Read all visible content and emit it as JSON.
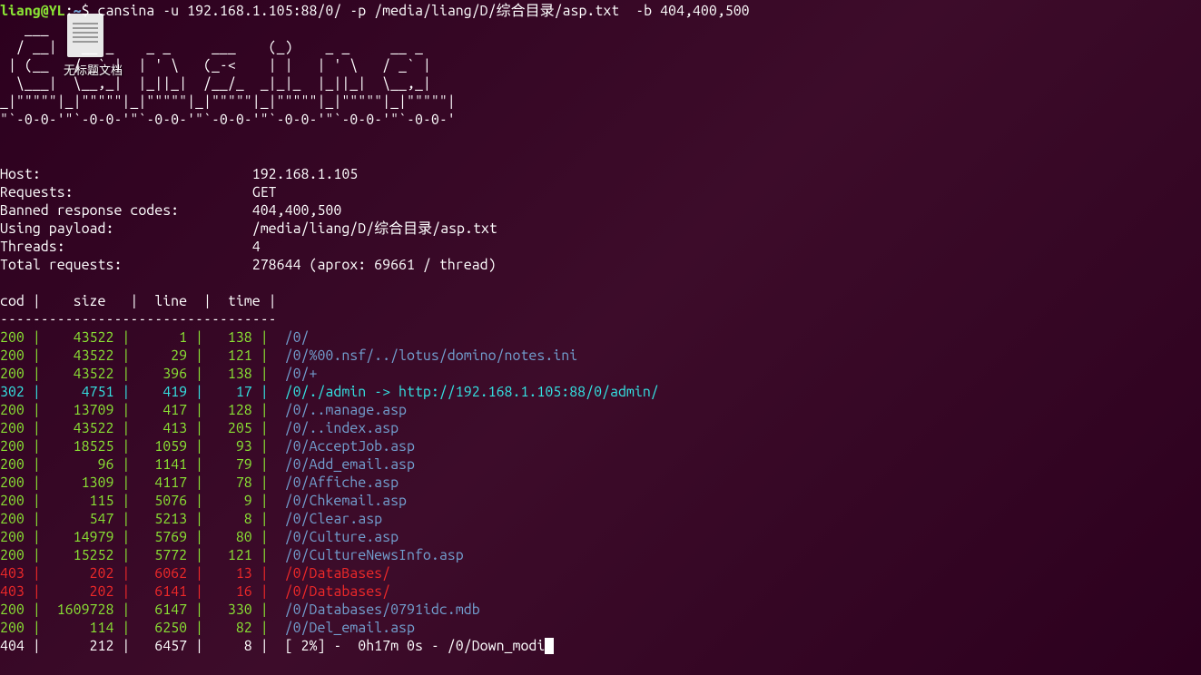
{
  "desktop": {
    "doc_label": "无标题文档"
  },
  "prompt": {
    "user_host": "liang@YL",
    "colon": ":",
    "path": "~",
    "dollar": "$ ",
    "command": "cansina -u 192.168.1.105:88/0/ -p /media/liang/D/综合目录/asp.txt  -b 404,400,500"
  },
  "ascii": [
    "   ___                                             ",
    "  / __|   __ _    _ _     ___    (_)    _ _     __ _  ",
    " | (__   / _` |  | ' \\   (_-<    | |   | ' \\   / _` | ",
    "  \\___|  \\__,_|  |_||_|  /__/_  _|_|_  |_||_|  \\__,_| ",
    "_|\"\"\"\"\"|_|\"\"\"\"\"|_|\"\"\"\"\"|_|\"\"\"\"\"|_|\"\"\"\"\"|_|\"\"\"\"\"|_|\"\"\"\"\"| ",
    "\"`-0-0-'\"`-0-0-'\"`-0-0-'\"`-0-0-'\"`-0-0-'\"`-0-0-'\"`-0-0-' "
  ],
  "info": {
    "host_label": "Host:",
    "host_value": "192.168.1.105",
    "requests_label": "Requests:",
    "requests_value": "GET",
    "banned_label": "Banned response codes:",
    "banned_value": "404,400,500",
    "payload_label": "Using payload:",
    "payload_value": "/media/liang/D/综合目录/asp.txt",
    "threads_label": "Threads:",
    "threads_value": "4",
    "total_label": "Total requests:",
    "total_value": "278644 (aprox: 69661 / thread)"
  },
  "table": {
    "header": "cod |    size   |  line  |  time |",
    "divider": "----------------------------------",
    "rows": [
      {
        "code": "200",
        "size": "43522",
        "line": "1",
        "time": "138",
        "path": "/0/",
        "cls": "c200",
        "pcls": "path-normal"
      },
      {
        "code": "200",
        "size": "43522",
        "line": "29",
        "time": "121",
        "path": "/0/%00.nsf/../lotus/domino/notes.ini",
        "cls": "c200",
        "pcls": "path-normal"
      },
      {
        "code": "200",
        "size": "43522",
        "line": "396",
        "time": "138",
        "path": "/0/+",
        "cls": "c200",
        "pcls": "path-normal"
      },
      {
        "code": "302",
        "size": "4751",
        "line": "419",
        "time": "17",
        "path": "/0/./admin -> http://192.168.1.105:88/0/admin/",
        "cls": "c302",
        "pcls": "path-redir"
      },
      {
        "code": "200",
        "size": "13709",
        "line": "417",
        "time": "128",
        "path": "/0/..manage.asp",
        "cls": "c200",
        "pcls": "path-normal"
      },
      {
        "code": "200",
        "size": "43522",
        "line": "413",
        "time": "205",
        "path": "/0/..index.asp",
        "cls": "c200",
        "pcls": "path-normal"
      },
      {
        "code": "200",
        "size": "18525",
        "line": "1059",
        "time": "93",
        "path": "/0/AcceptJob.asp",
        "cls": "c200",
        "pcls": "path-normal"
      },
      {
        "code": "200",
        "size": "96",
        "line": "1141",
        "time": "79",
        "path": "/0/Add_email.asp",
        "cls": "c200",
        "pcls": "path-normal"
      },
      {
        "code": "200",
        "size": "1309",
        "line": "4117",
        "time": "78",
        "path": "/0/Affiche.asp",
        "cls": "c200",
        "pcls": "path-normal"
      },
      {
        "code": "200",
        "size": "115",
        "line": "5076",
        "time": "9",
        "path": "/0/Chkemail.asp",
        "cls": "c200",
        "pcls": "path-normal"
      },
      {
        "code": "200",
        "size": "547",
        "line": "5213",
        "time": "8",
        "path": "/0/Clear.asp",
        "cls": "c200",
        "pcls": "path-normal"
      },
      {
        "code": "200",
        "size": "14979",
        "line": "5769",
        "time": "80",
        "path": "/0/Culture.asp",
        "cls": "c200",
        "pcls": "path-normal"
      },
      {
        "code": "200",
        "size": "15252",
        "line": "5772",
        "time": "121",
        "path": "/0/CultureNewsInfo.asp",
        "cls": "c200",
        "pcls": "path-normal"
      },
      {
        "code": "403",
        "size": "202",
        "line": "6062",
        "time": "13",
        "path": "/0/DataBases/",
        "cls": "c403",
        "pcls": "path-err"
      },
      {
        "code": "403",
        "size": "202",
        "line": "6141",
        "time": "16",
        "path": "/0/Databases/",
        "cls": "c403",
        "pcls": "path-err"
      },
      {
        "code": "200",
        "size": "1609728",
        "line": "6147",
        "time": "330",
        "path": "/0/Databases/0791idc.mdb",
        "cls": "c200",
        "pcls": "path-normal"
      },
      {
        "code": "200",
        "size": "114",
        "line": "6250",
        "time": "82",
        "path": "/0/Del_email.asp",
        "cls": "c200",
        "pcls": "path-normal"
      }
    ],
    "status": {
      "code": "404",
      "size": "212",
      "line": "6457",
      "time": "8",
      "text": "[ 2%] -  0h17m 0s - /0/Down_modi",
      "cls": "c404"
    }
  }
}
